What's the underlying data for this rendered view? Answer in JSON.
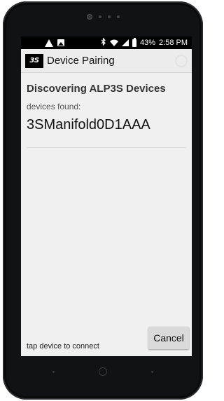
{
  "status_bar": {
    "battery": "43%",
    "time": "2:58 PM"
  },
  "app_bar": {
    "logo_text": "3S",
    "title": "Device Pairing"
  },
  "main": {
    "heading": "Discovering ALP3S Devices",
    "found_label": "devices found:",
    "devices": [
      "3SManifold0D1AAA"
    ]
  },
  "footer": {
    "hint": "tap device to connect",
    "cancel_label": "Cancel"
  }
}
